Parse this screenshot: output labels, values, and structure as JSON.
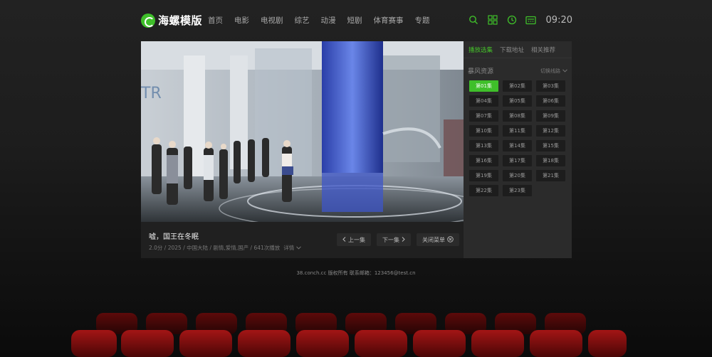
{
  "header": {
    "logo_text": "海螺模版",
    "nav": [
      "首页",
      "电影",
      "电视剧",
      "综艺",
      "动漫",
      "短剧",
      "体育赛事",
      "专题"
    ],
    "icons": [
      "search-icon",
      "grid-icon",
      "history-icon",
      "message-icon"
    ],
    "time": "09:20",
    "accent": "#3fbf2a"
  },
  "video": {
    "title": "嘘，国王在冬眠",
    "meta": "2.0分 / 2025 / 中国大陆 / 剧情,爱情,国产 / 641次播放",
    "detail_label": "详情",
    "prev_label": "上一集",
    "next_label": "下一集",
    "close_label": "关闭菜单"
  },
  "side": {
    "tabs": [
      "播放选集",
      "下载地址",
      "相关推荐"
    ],
    "source_name": "暴风资源",
    "switch_label": "切换线路",
    "episodes": [
      "第01集",
      "第02集",
      "第03集",
      "第04集",
      "第05集",
      "第06集",
      "第07集",
      "第08集",
      "第09集",
      "第10集",
      "第11集",
      "第12集",
      "第13集",
      "第14集",
      "第15集",
      "第16集",
      "第17集",
      "第18集",
      "第19集",
      "第20集",
      "第21集",
      "第22集",
      "第23集"
    ],
    "active_episode": "第01集"
  },
  "footer": {
    "text": "38.conch.cc 版权所有 联系邮箱：123456@test.cn"
  }
}
